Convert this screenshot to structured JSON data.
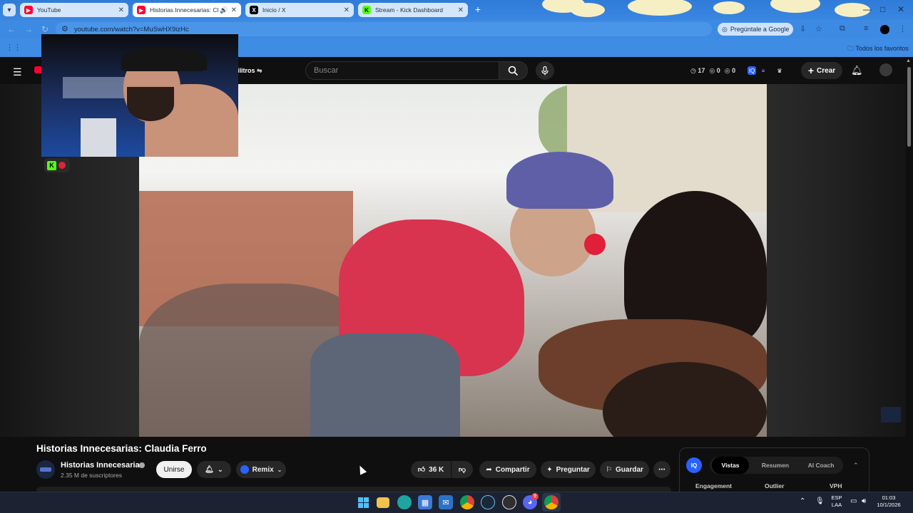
{
  "browser": {
    "tabs": [
      {
        "label": "YouTube",
        "favicon": "youtube-icon",
        "active": false
      },
      {
        "label": "Historias Innecesarias: Claudia Ferro",
        "favicon": "youtube-icon",
        "active": true
      },
      {
        "label": "Inicio / X",
        "favicon": "x-icon",
        "active": false
      },
      {
        "label": "Stream - Kick Dashboard",
        "favicon": "kick-icon",
        "active": false
      }
    ],
    "url": "youtube.com/watch?v=MuSwHX9izHc",
    "ask_google": "Pregúntale a Google",
    "bookmarks_all": "Todos los favoritos"
  },
  "youtube": {
    "search_placeholder": "Buscar",
    "filters_label": "ilitros",
    "stats": {
      "first": "17",
      "second": "0",
      "third": "0"
    },
    "create_label": "Crear",
    "video": {
      "title": "Historias Innecesarias: Claudia Ferro",
      "channel": "Historias Innecesarias",
      "subscribers": "2.35 M de suscriptores",
      "join_label": "Unirse",
      "remix_label": "Remix",
      "likes": "36 K",
      "share_label": "Compartir",
      "ask_label": "Preguntar",
      "save_label": "Guardar"
    },
    "vidiq": {
      "logo": "IQ",
      "tabs": [
        {
          "label": "Vistas",
          "selected": true
        },
        {
          "label": "Resumen",
          "selected": false
        },
        {
          "label": "AI Coach",
          "selected": false
        }
      ],
      "columns": [
        "Engagement",
        "Outlier",
        "VPH"
      ]
    }
  },
  "taskbar": {
    "language": "ESP",
    "layout": "LAA",
    "time": "01:03",
    "date": "10/1/2026",
    "discord_badge": "9"
  },
  "colors": {
    "youtube_red": "#ff0033",
    "kick_green": "#53fc18",
    "vidiq_blue": "#2962ff",
    "tabbar_blue": "#3a87e2"
  }
}
